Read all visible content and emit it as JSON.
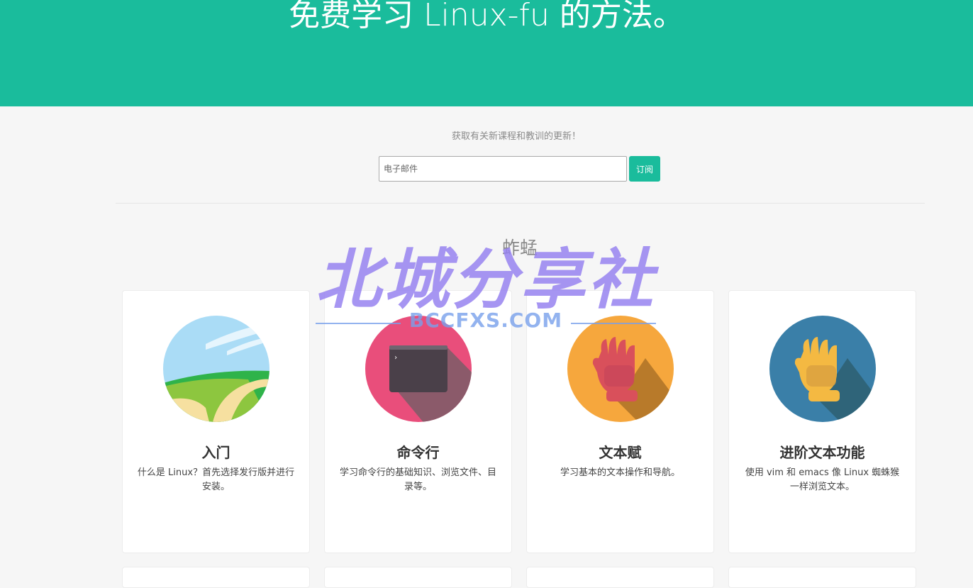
{
  "hero": {
    "title": "免费学习 Linux-fu 的方法。",
    "background": "#1abc9c"
  },
  "subscribe": {
    "text": "获取有关新课程和教训的更新！",
    "email_placeholder": "电子邮件",
    "button_label": "订阅"
  },
  "section": {
    "title": "蚱蜢"
  },
  "cards": [
    {
      "icon": "landscape-icon",
      "title": "入门",
      "desc": "什么是 Linux？首先选择发行版并进行安装。"
    },
    {
      "icon": "terminal-icon",
      "title": "命令行",
      "desc": "学习命令行的基础知识、浏览文件、目录等。"
    },
    {
      "icon": "glove-icon",
      "title": "文本赋",
      "desc": "学习基本的文本操作和导航。"
    },
    {
      "icon": "glove-icon",
      "title": "进阶文本功能",
      "desc": "使用 vim 和 emacs 像 Linux 蜘蛛猴一样浏览文本。"
    }
  ],
  "watermark": {
    "text": "北城分享社",
    "url": "BCCFXS.COM"
  }
}
